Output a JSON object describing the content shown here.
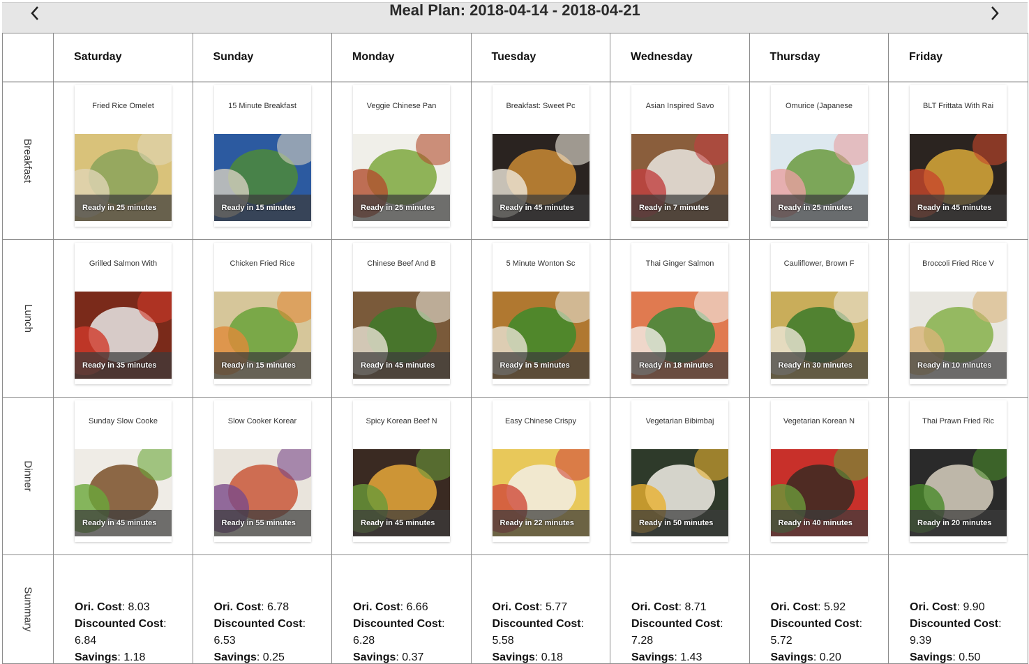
{
  "header": {
    "title": "Meal Plan: 2018-04-14 - 2018-04-21"
  },
  "days": [
    "Saturday",
    "Sunday",
    "Monday",
    "Tuesday",
    "Wednesday",
    "Thursday",
    "Friday"
  ],
  "meals": [
    "Breakfast",
    "Lunch",
    "Dinner",
    "Summary"
  ],
  "recipes": {
    "breakfast": [
      {
        "title": "Fried Rice Omelet",
        "ready": "Ready in 25 minutes",
        "c1": "#d9c27a",
        "c2": "#8aa35a",
        "c3": "#e0d5b5"
      },
      {
        "title": "15 Minute Breakfast",
        "ready": "Ready in 15 minutes",
        "c1": "#2c5aa0",
        "c2": "#4e8a3a",
        "c3": "#d7d0c0"
      },
      {
        "title": "Veggie Chinese Pan",
        "ready": "Ready in 25 minutes",
        "c1": "#f0efe9",
        "c2": "#7ea83e",
        "c3": "#b24d2e"
      },
      {
        "title": "Breakfast: Sweet Pc",
        "ready": "Ready in 45 minutes",
        "c1": "#2a2320",
        "c2": "#c98a35",
        "c3": "#efe8dc"
      },
      {
        "title": "Asian Inspired Savo",
        "ready": "Ready in 7 minutes",
        "c1": "#8a5e3c",
        "c2": "#e9e6e0",
        "c3": "#c04040"
      },
      {
        "title": "Omurice (Japanese",
        "ready": "Ready in 25 minutes",
        "c1": "#dde8ef",
        "c2": "#6b9a3e",
        "c3": "#e8a0a0"
      },
      {
        "title": "BLT Frittata With Rai",
        "ready": "Ready in 45 minutes",
        "c1": "#2b2420",
        "c2": "#d9a93a",
        "c3": "#c8472c"
      }
    ],
    "lunch": [
      {
        "title": "Grilled Salmon With",
        "ready": "Ready in 35 minutes",
        "c1": "#7a2a1a",
        "c2": "#e8e8e8",
        "c3": "#d03a2a"
      },
      {
        "title": "Chicken Fried Rice",
        "ready": "Ready in 15 minutes",
        "c1": "#d6c69a",
        "c2": "#6aa23a",
        "c3": "#e08a3a"
      },
      {
        "title": "Chinese Beef And B",
        "ready": "Ready in 45 minutes",
        "c1": "#7a5a3a",
        "c2": "#3f7a2a",
        "c3": "#e8e2d5"
      },
      {
        "title": "5 Minute Wonton Sc",
        "ready": "Ready in 5 minutes",
        "c1": "#b07830",
        "c2": "#3f8a2a",
        "c3": "#e8e2d5"
      },
      {
        "title": "Thai Ginger Salmon",
        "ready": "Ready in 18 minutes",
        "c1": "#e07a50",
        "c2": "#3f8a3a",
        "c3": "#f2efe9"
      },
      {
        "title": "Cauliflower, Brown F",
        "ready": "Ready in 30 minutes",
        "c1": "#c9ad5a",
        "c2": "#3c7a2a",
        "c3": "#ece6d8"
      },
      {
        "title": "Broccoli Fried Rice V",
        "ready": "Ready in 10 minutes",
        "c1": "#e8e6e0",
        "c2": "#86b04a",
        "c3": "#d8b478"
      }
    ],
    "dinner": [
      {
        "title": "Sunday Slow Cooke",
        "ready": "Ready in 45 minutes",
        "c1": "#efece6",
        "c2": "#7a5028",
        "c3": "#6aa83a"
      },
      {
        "title": "Slow Cooker Korear",
        "ready": "Ready in 55 minutes",
        "c1": "#e9e4dc",
        "c2": "#c9583a",
        "c3": "#7a4a8a"
      },
      {
        "title": "Spicy Korean Beef N",
        "ready": "Ready in 45 minutes",
        "c1": "#3a2a22",
        "c2": "#e8a83a",
        "c3": "#6a9a3a"
      },
      {
        "title": "Easy Chinese Crispy",
        "ready": "Ready in 22 minutes",
        "c1": "#e8c85a",
        "c2": "#f2ede4",
        "c3": "#d04a3a"
      },
      {
        "title": "Vegetarian Bibimbaj",
        "ready": "Ready in 50 minutes",
        "c1": "#2e3a2a",
        "c2": "#f2f0e8",
        "c3": "#e8b030"
      },
      {
        "title": "Vegetarian Korean N",
        "ready": "Ready in 40 minutes",
        "c1": "#c8302a",
        "c2": "#3a2a22",
        "c3": "#6a9a3a"
      },
      {
        "title": "Thai Prawn Fried Ric",
        "ready": "Ready in 20 minutes",
        "c1": "#2a2a2a",
        "c2": "#d8d0c0",
        "c3": "#4a8a2a"
      }
    ]
  },
  "summary_labels": {
    "ori": "Ori. Cost",
    "disc": "Discounted Cost",
    "sav": "Savings"
  },
  "summary": [
    {
      "ori": ": 8.03",
      "disc": ":",
      "disc_val": "6.84",
      "sav": ": 1.18"
    },
    {
      "ori": ": 6.78",
      "disc": ":",
      "disc_val": "6.53",
      "sav": ": 0.25"
    },
    {
      "ori": ": 6.66",
      "disc": ":",
      "disc_val": "6.28",
      "sav": ": 0.37"
    },
    {
      "ori": ": 5.77",
      "disc": ":",
      "disc_val": "5.58",
      "sav": ": 0.18"
    },
    {
      "ori": ": 8.71",
      "disc": ":",
      "disc_val": "7.28",
      "sav": ": 1.43"
    },
    {
      "ori": ": 5.92",
      "disc": ":",
      "disc_val": "5.72",
      "sav": ": 0.20"
    },
    {
      "ori": ": 9.90",
      "disc": ":",
      "disc_val": "9.39",
      "sav": ": 0.50"
    }
  ]
}
